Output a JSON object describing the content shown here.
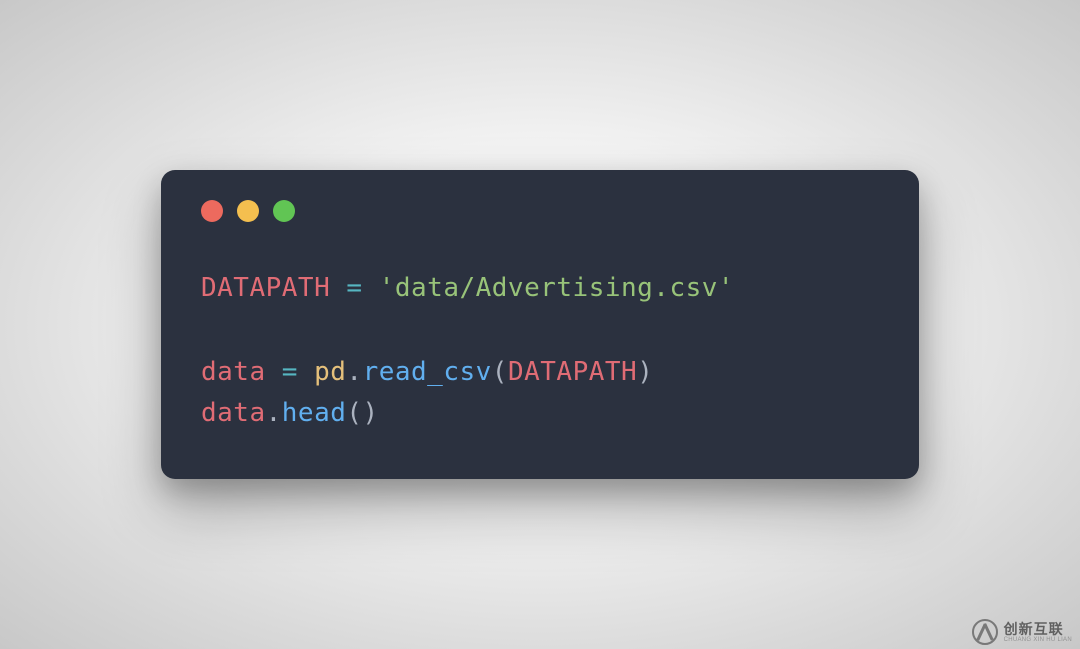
{
  "code": {
    "line1": {
      "const": "DATAPATH",
      "op": " = ",
      "str": "'data/Advertising.csv'"
    },
    "line3": {
      "ident": "data",
      "op": " = ",
      "obj": "pd",
      "dot": ".",
      "func": "read_csv",
      "lp": "(",
      "arg": "DATAPATH",
      "rp": ")"
    },
    "line4": {
      "ident": "data",
      "dot": ".",
      "func": "head",
      "parens": "()"
    }
  },
  "watermark": {
    "main": "创新互联",
    "sub": "CHUANG XIN HU LIAN"
  }
}
